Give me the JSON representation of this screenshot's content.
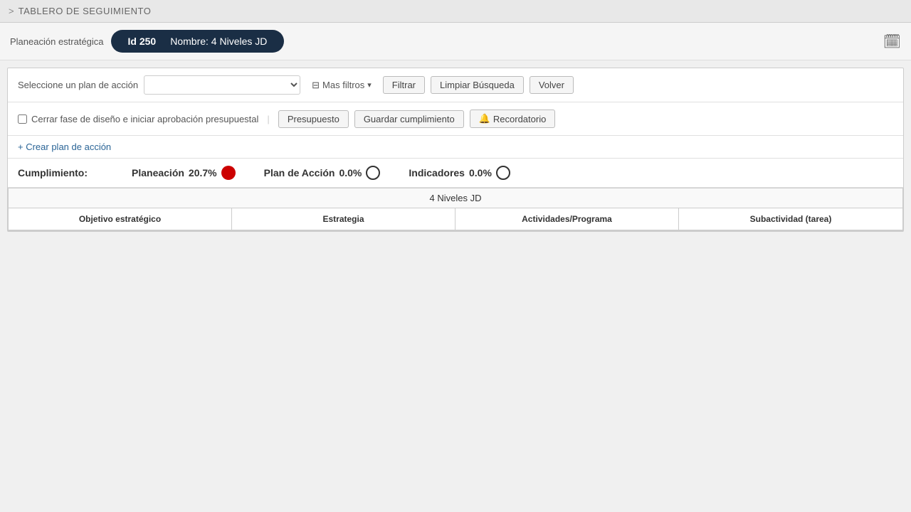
{
  "topbar": {
    "arrow": ">",
    "title": "TABLERO DE SEGUIMIENTO"
  },
  "breadcrumb": {
    "label": "Planeación estratégica",
    "pill": {
      "id_label": "Id 250",
      "name_label": "Nombre: 4 Niveles JD"
    },
    "calendar_icon": "🗓"
  },
  "filter": {
    "select_label": "Seleccione un plan de acción",
    "select_placeholder": "",
    "mas_filtros": "Mas filtros",
    "btn_filtrar": "Filtrar",
    "btn_limpiar": "Limpiar Búsqueda",
    "btn_volver": "Volver"
  },
  "actions": {
    "checkbox_label": "Cerrar fase de diseño e iniciar aprobación presupuestal",
    "btn_presupuesto": "Presupuesto",
    "btn_guardar": "Guardar cumplimiento",
    "btn_recordatorio": "Recordatorio"
  },
  "create": {
    "link_label": "+ Crear plan de acción"
  },
  "cumplimiento": {
    "label": "Cumplimiento:",
    "planeacion": {
      "name": "Planeación",
      "value": "20.7%",
      "indicator": "red"
    },
    "plan_accion": {
      "name": "Plan de Acción",
      "value": "0.0%",
      "indicator": "empty"
    },
    "indicadores": {
      "name": "Indicadores",
      "value": "0.0%",
      "indicator": "empty"
    }
  },
  "table": {
    "group_header": "4 Niveles JD",
    "columns": [
      "Objetivo estratégico",
      "Estrategia",
      "Actividades/Programa",
      "Subactividad (tarea)"
    ]
  },
  "icons": {
    "filter_unicode": "⊟",
    "chevron": "∨",
    "bell_unicode": "🔔"
  }
}
